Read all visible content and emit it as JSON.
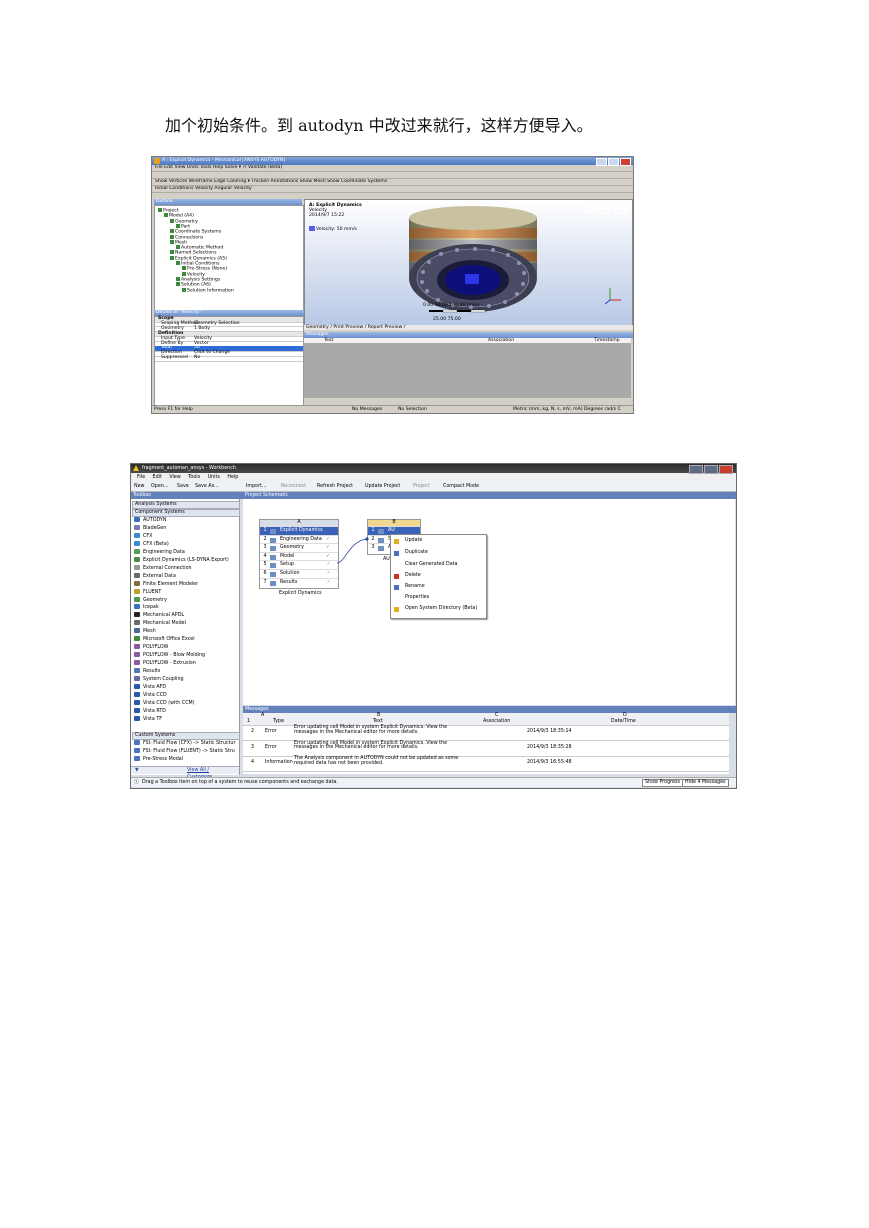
{
  "caption": "加个初始条件。到 autodyn 中改过来就行，这样方便导入。",
  "mech": {
    "window_title": "A : Explicit Dynamics - Mechanical [ANSYS AUTODYN]",
    "menu": "File  Edit  View  Units  Tools  Help   Solve ▾  ?/ Validate (Beta)",
    "toolbar2": "Show Vertices  Wireframe  Edge Coloring ▾   Thicken Annotations  Show Mesh  Show Coordinate Systems",
    "toolbar3": "Initial Conditions  Velocity  Angular Velocity",
    "outline_title": "Outline",
    "tree": [
      {
        "label": "Project",
        "indent": 0
      },
      {
        "label": "Model (A4)",
        "indent": 1
      },
      {
        "label": "Geometry",
        "indent": 2
      },
      {
        "label": "Part",
        "indent": 3
      },
      {
        "label": "Coordinate Systems",
        "indent": 2
      },
      {
        "label": "Connections",
        "indent": 2
      },
      {
        "label": "Mesh",
        "indent": 2
      },
      {
        "label": "Automatic Method",
        "indent": 3
      },
      {
        "label": "Named Selections",
        "indent": 2
      },
      {
        "label": "Explicit Dynamics (A5)",
        "indent": 2
      },
      {
        "label": "Initial Conditions",
        "indent": 3
      },
      {
        "label": "Pre-Stress (None)",
        "indent": 4
      },
      {
        "label": "Velocity",
        "indent": 4
      },
      {
        "label": "Analysis Settings",
        "indent": 3
      },
      {
        "label": "Solution (A6)",
        "indent": 3
      },
      {
        "label": "Solution Information",
        "indent": 4
      }
    ],
    "details_title": "Details of \"Velocity\"",
    "details": [
      {
        "k": "Scope",
        "v": "",
        "sec": true
      },
      {
        "k": "Scoping Method",
        "v": "Geometry Selection"
      },
      {
        "k": "Geometry",
        "v": "1 Body"
      },
      {
        "k": "Definition",
        "v": "",
        "sec": true
      },
      {
        "k": "Input Type",
        "v": "Velocity"
      },
      {
        "k": "Define By",
        "v": "Vector"
      },
      {
        "k": "Total",
        "v": "50",
        "sel": true
      },
      {
        "k": "Direction",
        "v": "Click to Change"
      },
      {
        "k": "Suppressed",
        "v": "No"
      }
    ],
    "vp_title": "A: Explicit Dynamics",
    "vp_sub1": "Velocity",
    "vp_sub2": "2014/9/7 15:22",
    "legend": "Velocity: 50 mm/s",
    "logo": "ANSYS",
    "logo_ver": "14.0",
    "scale_top": "0.00        50.00        100.00 (mm)",
    "scale_bottom": "25.00        75.00",
    "tabs": "Geometry / Print Preview / Report Preview /",
    "msgs_title": "Messages",
    "msgs_cols": [
      "Text",
      "Association",
      "Timestamp"
    ],
    "status_help": "Press F1 for Help",
    "status_msgs": "No Messages",
    "status_sel": "No Selection",
    "status_units": "Metric (mm, kg, N, s, mV, mA)  Degrees  rad/s  C"
  },
  "wb": {
    "window_title": "fragment_automan_ansys - Workbench",
    "menu": "File Edit View Tools Units Help",
    "toolbar": [
      "New",
      "Open...",
      "Save",
      "Save As...",
      "Import...",
      "Reconnect",
      "Refresh Project",
      "Update Project",
      "Project",
      "Compact Mode"
    ],
    "toolbox_title": "Toolbox",
    "sec_analysis": "Analysis Systems",
    "sec_component": "Component Systems",
    "components": [
      "AUTODYN",
      "BladeGen",
      "CFX",
      "CFX (Beta)",
      "Engineering Data",
      "Explicit Dynamics (LS-DYNA Export)",
      "External Connection",
      "External Data",
      "Finite Element Modeler",
      "FLUENT",
      "Geometry",
      "Icepak",
      "Mechanical APDL",
      "Mechanical Model",
      "Mesh",
      "Microsoft Office Excel",
      "POLYFLOW",
      "POLYFLOW - Blow Molding",
      "POLYFLOW - Extrusion",
      "Results",
      "System Coupling",
      "Vista AFD",
      "Vista CCD",
      "Vista CCD (with CCM)",
      "Vista RTD",
      "Vista TF"
    ],
    "sec_custom": "Custom Systems",
    "custom": [
      "FSI: Fluid Flow (CFX) -> Static Structur",
      "FSI: Fluid Flow (FLUENT) -> Static Stru",
      "Pre-Stress Modal"
    ],
    "view_all": "View All / Customize...",
    "schematic_title": "Project Schematic",
    "sysA_col": "A",
    "sysA_rows": [
      {
        "n": "1",
        "label": "Explicit Dynamics",
        "st": ""
      },
      {
        "n": "2",
        "label": "Engineering Data",
        "st": "✓"
      },
      {
        "n": "3",
        "label": "Geometry",
        "st": "✓"
      },
      {
        "n": "4",
        "label": "Model",
        "st": "✓"
      },
      {
        "n": "5",
        "label": "Setup",
        "st": "⚡"
      },
      {
        "n": "6",
        "label": "Solution",
        "st": "⚡"
      },
      {
        "n": "7",
        "label": "Results",
        "st": "⚡"
      }
    ],
    "sysA_caption": "Explicit Dynamics",
    "sysB_col": "B",
    "sysB_rows": [
      {
        "n": "1",
        "label": "AU"
      },
      {
        "n": "2",
        "label": "Se"
      },
      {
        "n": "3",
        "label": "An"
      }
    ],
    "sysB_caption": "AU",
    "ctx_menu": [
      "Update",
      "Duplicate",
      "Clear Generated Data",
      "Delete",
      "Rename",
      "Properties",
      "Open System Directory (Beta)"
    ],
    "msgs_title": "Messages",
    "msg_cols_letters": [
      "A",
      "B",
      "C",
      "D"
    ],
    "msg_cols": [
      "Type",
      "Text",
      "Association",
      "Date/Time"
    ],
    "messages": [
      {
        "n": "2",
        "type": "Error",
        "text": "Error updating cell Model in system Explicit Dynamics. View the messages in the Mechanical editor for more details.",
        "time": "2014/9/3 18:35:14"
      },
      {
        "n": "3",
        "type": "Error",
        "text": "Error updating cell Model in system Explicit Dynamics. View the messages in the Mechanical editor for more details.",
        "time": "2014/9/3 18:35:28"
      },
      {
        "n": "4",
        "type": "Information",
        "text": "The Analysis component in AUTODYN could not be updated as some required data has not been provided.",
        "time": "2014/9/3 16:55:48"
      }
    ],
    "status_text": "Drag a Toolbox item on top of a system to reuse components and exchange data.",
    "show_progress": "Show Progress",
    "hide_messages": "Hide 4 Messages"
  }
}
